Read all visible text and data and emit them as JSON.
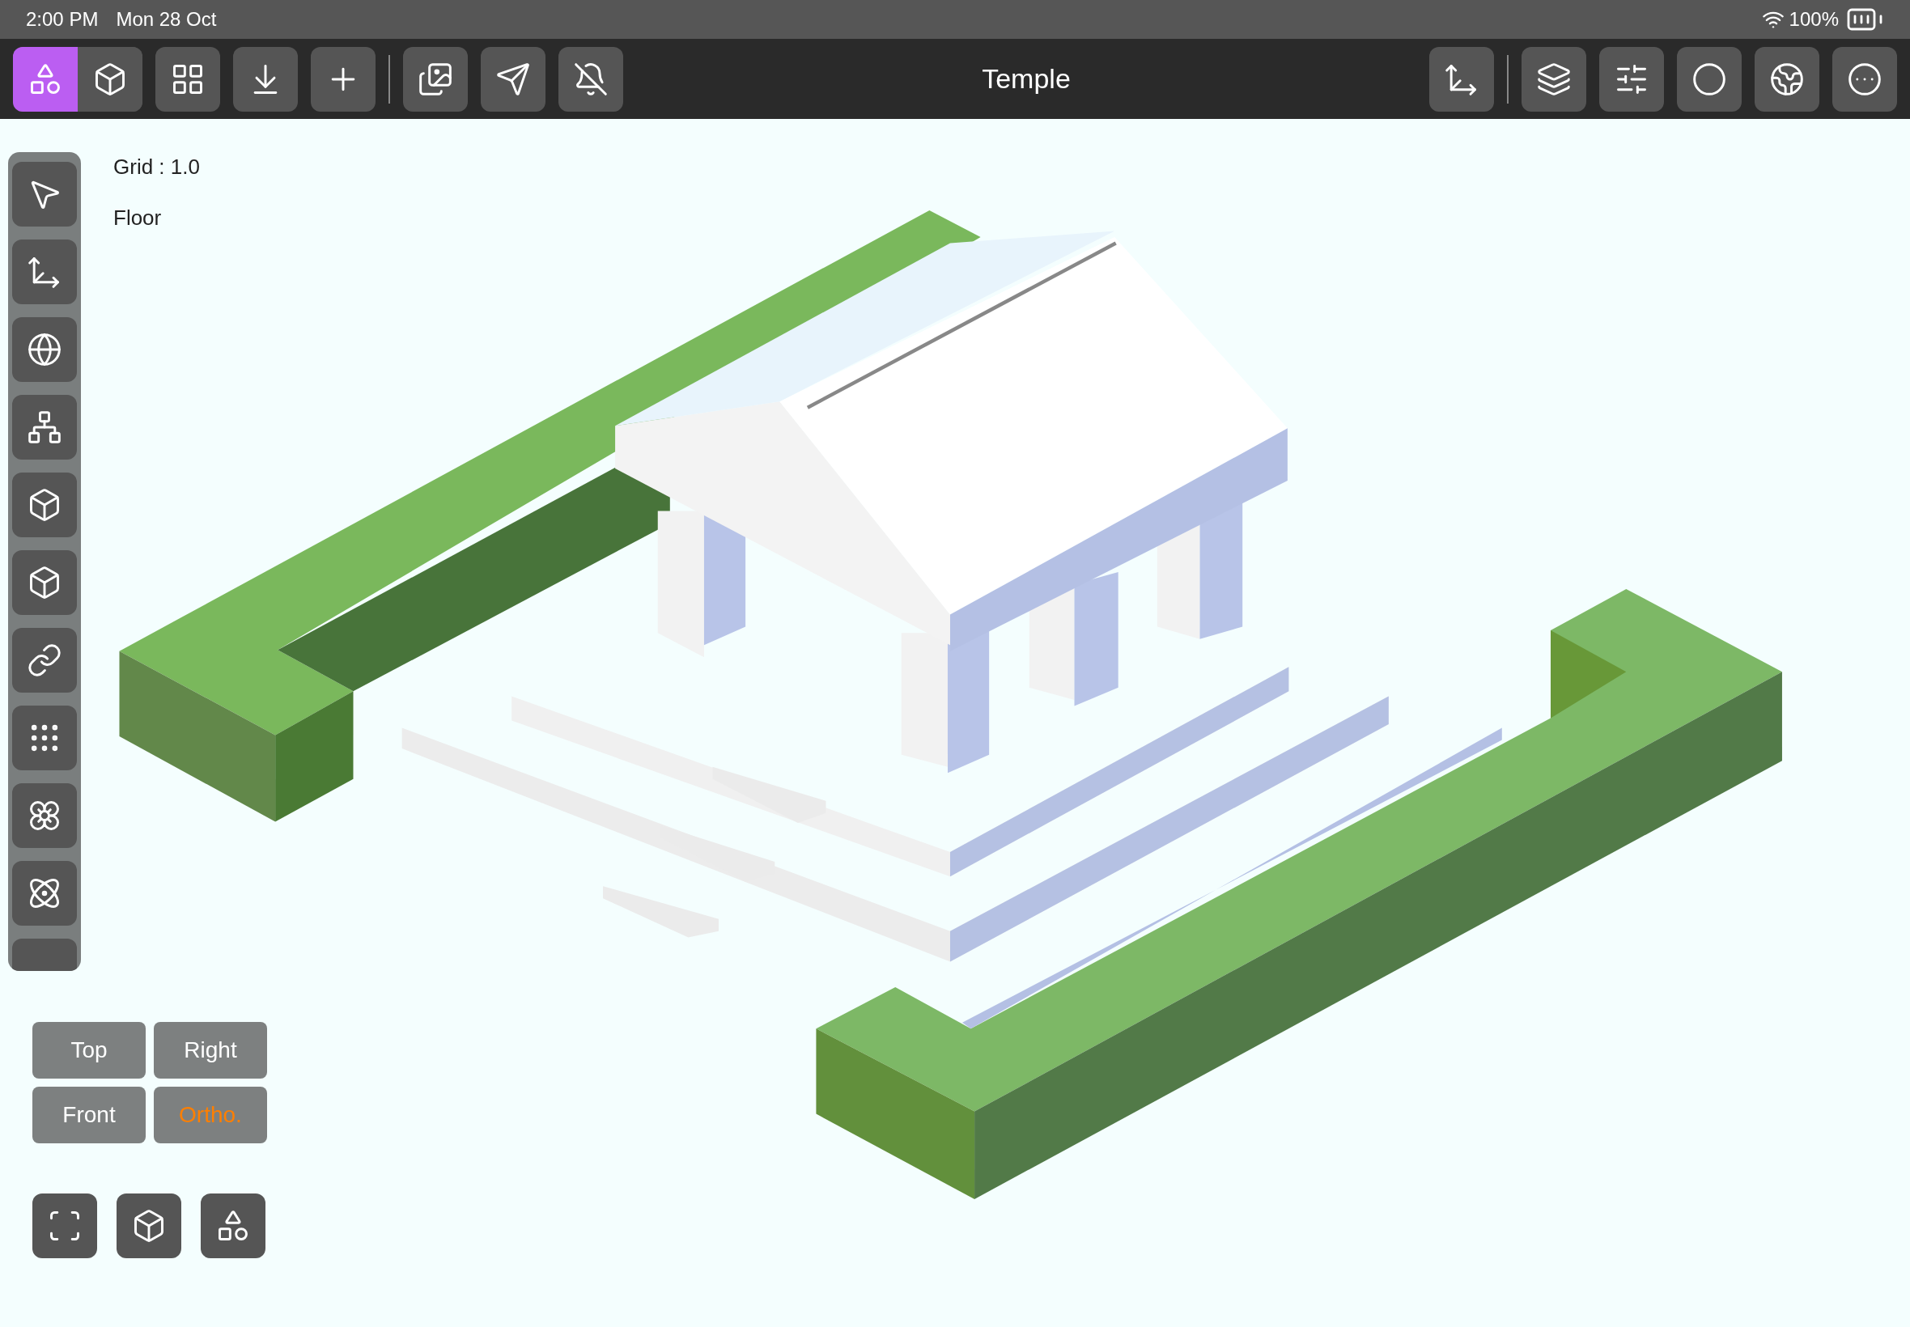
{
  "status_bar": {
    "time": "2:00 PM",
    "date": "Mon 28 Oct",
    "battery": "100%"
  },
  "toolbar": {
    "title": "Temple",
    "mode_tabs": [
      {
        "selected": true
      },
      {
        "selected": false
      }
    ]
  },
  "canvas": {
    "grid_label": "Grid : 1.0",
    "layer_label": "Floor"
  },
  "view_buttons": [
    {
      "label": "Top",
      "selected": false
    },
    {
      "label": "Right",
      "selected": false
    },
    {
      "label": "Front",
      "selected": false
    },
    {
      "label": "Ortho.",
      "selected": true
    }
  ]
}
